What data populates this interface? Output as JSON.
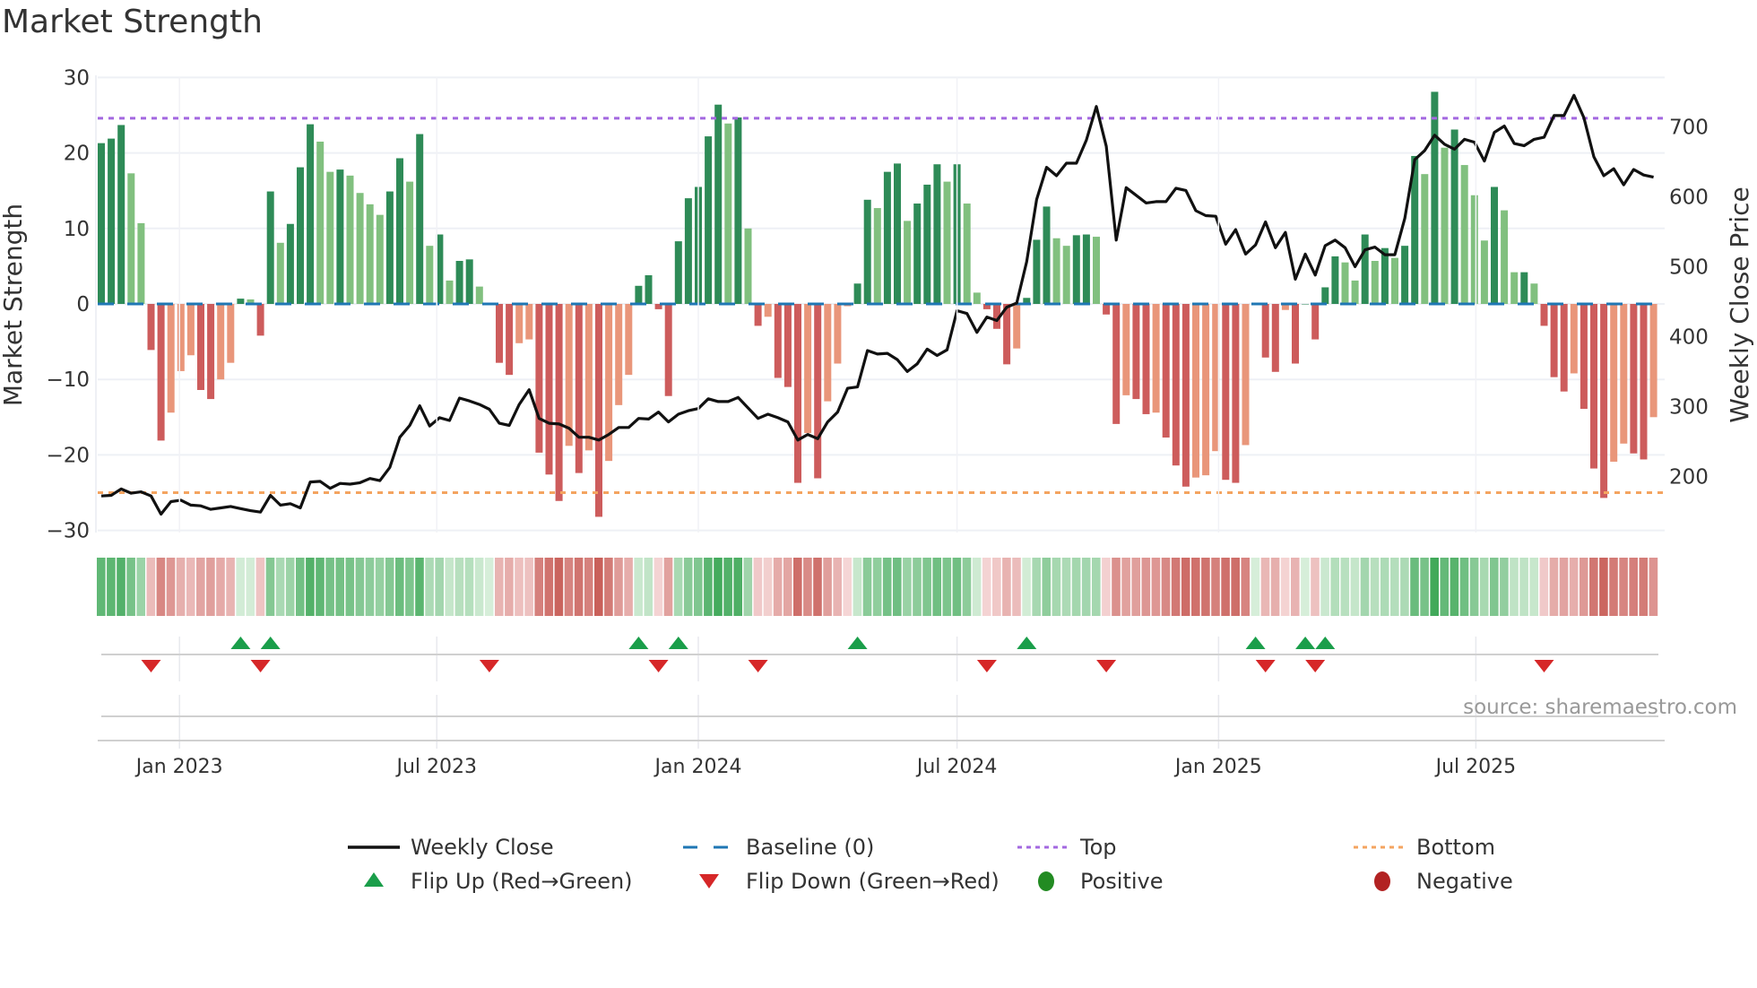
{
  "title": "Market Strength",
  "source_label": "source: sharemaestro.com",
  "chart_data": {
    "type": "bar",
    "title": "Market Strength",
    "ylabel": "Market Strength",
    "y2label": "Weekly Close Price",
    "ylim": [
      -30,
      30
    ],
    "yticks": [
      30,
      20,
      10,
      0,
      -10,
      -20,
      -30
    ],
    "ytick_labels": [
      "30",
      "20",
      "10",
      "0",
      "−10",
      "−20",
      "−30"
    ],
    "y2lim_ref": [
      200,
      700
    ],
    "y2ticks": [
      700,
      600,
      500,
      400,
      300,
      200
    ],
    "y2tick_labels": [
      "700",
      "600",
      "500",
      "400",
      "300",
      "200"
    ],
    "x_start": "2022-11-07",
    "x_step_days": 7,
    "xticks": [
      {
        "date": "2023-01-01",
        "label": "Jan 2023"
      },
      {
        "date": "2023-07-01",
        "label": "Jul 2023"
      },
      {
        "date": "2024-01-01",
        "label": "Jan 2024"
      },
      {
        "date": "2024-07-01",
        "label": "Jul 2024"
      },
      {
        "date": "2025-01-01",
        "label": "Jan 2025"
      },
      {
        "date": "2025-07-01",
        "label": "Jul 2025"
      }
    ],
    "top_level": 24.6,
    "bottom_level": -25,
    "strength": [
      21.3,
      21.9,
      23.7,
      17.3,
      10.7,
      -6.1,
      -18.1,
      -14.4,
      -8.9,
      -6.8,
      -11.4,
      -12.6,
      -10,
      -7.8,
      0.7,
      0.6,
      -4.2,
      14.9,
      8.1,
      10.6,
      18.1,
      23.8,
      21.5,
      17.5,
      17.8,
      17,
      14.7,
      13.2,
      11.8,
      14.9,
      19.3,
      16.2,
      22.5,
      7.7,
      9.2,
      3.1,
      5.7,
      5.9,
      2.3,
      0,
      -7.8,
      -9.4,
      -5.2,
      -4.7,
      -19.7,
      -22.6,
      -26.1,
      -18.8,
      -22.4,
      -19.4,
      -28.2,
      -20.8,
      -13.4,
      -9.4,
      2.4,
      3.8,
      -0.7,
      -12.2,
      8.3,
      14,
      15.5,
      22.2,
      26.4,
      23.9,
      24.7,
      10,
      -2.9,
      -1.7,
      -9.8,
      -11,
      -23.7,
      -17.1,
      -23.1,
      -12.9,
      -7.9,
      -0.3,
      2.7,
      13.8,
      12.7,
      17.5,
      18.6,
      11,
      13.3,
      15.8,
      18.5,
      16.2,
      18.5,
      13.3,
      1.5,
      -0.7,
      -3.3,
      -8,
      -5.9,
      0.8,
      8.5,
      12.9,
      8.7,
      7.7,
      9.1,
      9.2,
      8.9,
      -1.4,
      -15.9,
      -12.1,
      -12.6,
      -14.6,
      -14.4,
      -17.7,
      -21.4,
      -24.2,
      -23,
      -22.7,
      -19.5,
      -23.3,
      -23.7,
      -18.7,
      0,
      -7.1,
      -9,
      -0.8,
      -7.9,
      0,
      -4.7,
      2.2,
      6.3,
      5.5,
      3.1,
      9.2,
      5.7,
      7.4,
      6.1,
      7.7,
      19.6,
      17.2,
      28.1,
      20.7,
      23.1,
      18.4,
      14.4,
      8.4,
      15.5,
      12.4,
      4.2,
      4.2,
      2.7,
      -2.9,
      -9.7,
      -11.6,
      -9.2,
      -13.9,
      -21.8,
      -25.7,
      -20.9,
      -18.5,
      -19.8,
      -20.6,
      -15
    ],
    "weekly_close": [
      172,
      173,
      182,
      176,
      178,
      172,
      146,
      164,
      166,
      159,
      158,
      153,
      155,
      157,
      154,
      151,
      149,
      173,
      159,
      161,
      155,
      192,
      193,
      183,
      190,
      189,
      191,
      197,
      194,
      213,
      256,
      273,
      301,
      272,
      284,
      280,
      312,
      308,
      303,
      296,
      276,
      273,
      303,
      324,
      283,
      276,
      275,
      269,
      256,
      256,
      252,
      260,
      270,
      270,
      283,
      282,
      292,
      278,
      289,
      294,
      297,
      311,
      307,
      307,
      313,
      298,
      283,
      289,
      284,
      278,
      252,
      260,
      254,
      278,
      292,
      326,
      328,
      380,
      375,
      376,
      367,
      350,
      361,
      382,
      373,
      381,
      437,
      433,
      406,
      428,
      423,
      442,
      448,
      507,
      596,
      642,
      630,
      648,
      648,
      681,
      729,
      672,
      538,
      613,
      602,
      591,
      593,
      593,
      612,
      609,
      580,
      573,
      572,
      532,
      553,
      518,
      531,
      564,
      527,
      549,
      482,
      518,
      488,
      530,
      538,
      527,
      500,
      524,
      528,
      517,
      517,
      569,
      653,
      666,
      688,
      675,
      668,
      682,
      678,
      651,
      692,
      701,
      676,
      673,
      682,
      685,
      716,
      716,
      745,
      713,
      657,
      630,
      640,
      617,
      639,
      631,
      628
    ],
    "flip_up_weeks": [
      14,
      17,
      54,
      58,
      76,
      93,
      116,
      121,
      123
    ],
    "flip_down_weeks": [
      5,
      16,
      39,
      56,
      66,
      89,
      101,
      117,
      122,
      145
    ],
    "legend": {
      "placement": "bottom",
      "items": [
        {
          "key": "weekly_close",
          "label": "Weekly Close"
        },
        {
          "key": "baseline",
          "label": "Baseline (0)"
        },
        {
          "key": "top",
          "label": "Top"
        },
        {
          "key": "bottom",
          "label": "Bottom"
        },
        {
          "key": "flip_up",
          "label": "Flip Up (Red→Green)"
        },
        {
          "key": "flip_down",
          "label": "Flip Down (Green→Red)"
        },
        {
          "key": "positive",
          "label": "Positive"
        },
        {
          "key": "negative",
          "label": "Negative"
        }
      ]
    },
    "colors": {
      "pos_strong": "#2e8b57",
      "pos_weak": "#81c07f",
      "neg_strong": "#cd5c5c",
      "neg_weak": "#e9967a",
      "close": "#111111",
      "baseline": "#1f77b4",
      "top": "#a368e0",
      "bottom": "#f4a460",
      "flip_up": "#1a9e4a",
      "flip_down": "#d62728",
      "positive": "#228b22",
      "negative": "#b22222"
    }
  }
}
